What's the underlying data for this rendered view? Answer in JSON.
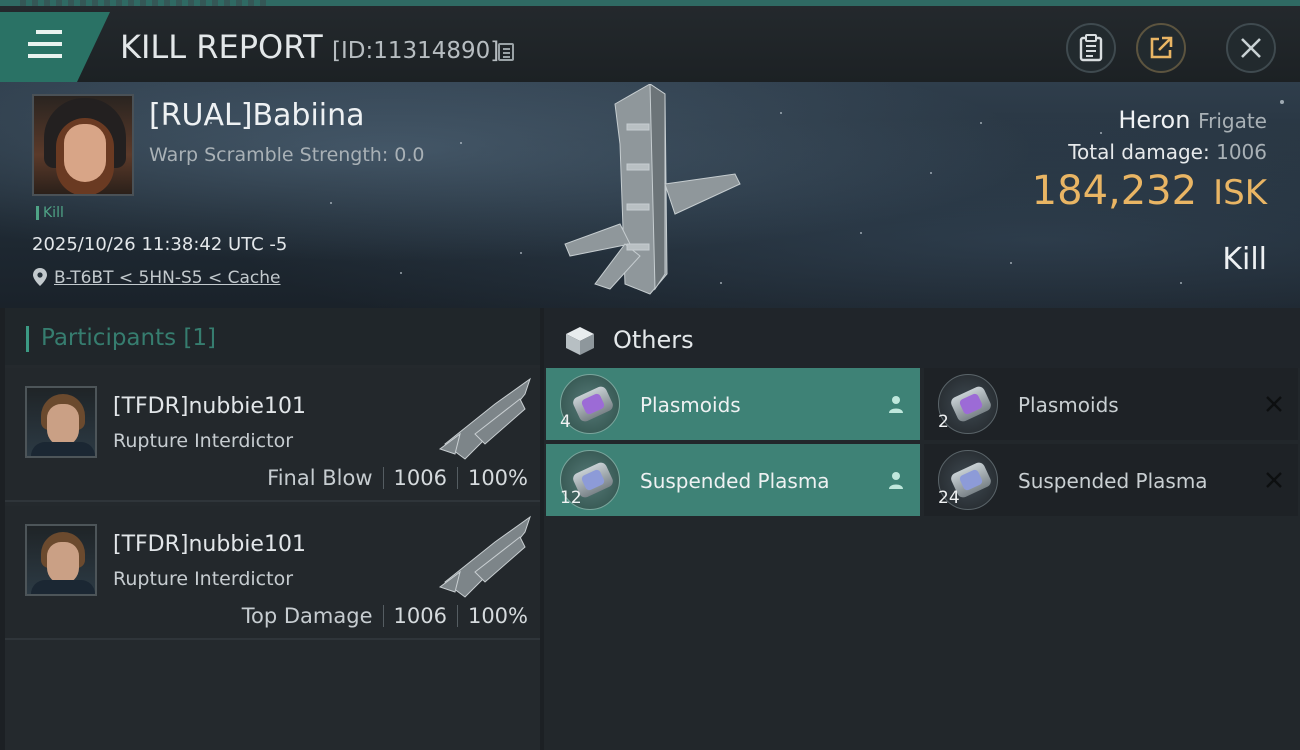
{
  "header": {
    "title": "KILL REPORT",
    "report_id": "[ID:11314890]"
  },
  "victim": {
    "name": "[RUAL]Babiina",
    "warp_scramble": "Warp Scramble Strength: 0.0",
    "tag": "Kill",
    "datetime": "2025/10/26 11:38:42 UTC -5",
    "location": "B-T6BT < 5HN-S5 < Cache",
    "ship_name": "Heron",
    "ship_class": "Frigate",
    "total_damage_label": "Total damage:",
    "total_damage": "1006",
    "isk_value": "184,232",
    "isk_unit": "ISK",
    "result": "Kill"
  },
  "participants": {
    "label": "Participants [1]",
    "items": [
      {
        "name": "[TFDR]nubbie101",
        "ship": "Rupture Interdictor",
        "role": "Final Blow",
        "damage": "1006",
        "percent": "100%"
      },
      {
        "name": "[TFDR]nubbie101",
        "ship": "Rupture Interdictor",
        "role": "Top Damage",
        "damage": "1006",
        "percent": "100%"
      }
    ]
  },
  "others": {
    "label": "Others",
    "items": [
      {
        "name": "Plasmoids",
        "qty": "4",
        "status": "dropped"
      },
      {
        "name": "Plasmoids",
        "qty": "2",
        "status": "destroyed"
      },
      {
        "name": "Suspended Plasma",
        "qty": "12",
        "status": "dropped"
      },
      {
        "name": "Suspended Plasma",
        "qty": "24",
        "status": "destroyed"
      }
    ]
  },
  "colors": {
    "accent_teal": "#3e8276",
    "isk_gold": "#e9b564",
    "kill_green": "#4fa486"
  },
  "icons": [
    "menu-icon",
    "copy-icon",
    "clipboard-icon",
    "share-icon",
    "close-icon",
    "location-pin-icon",
    "cube-icon",
    "person-icon",
    "x-icon"
  ]
}
